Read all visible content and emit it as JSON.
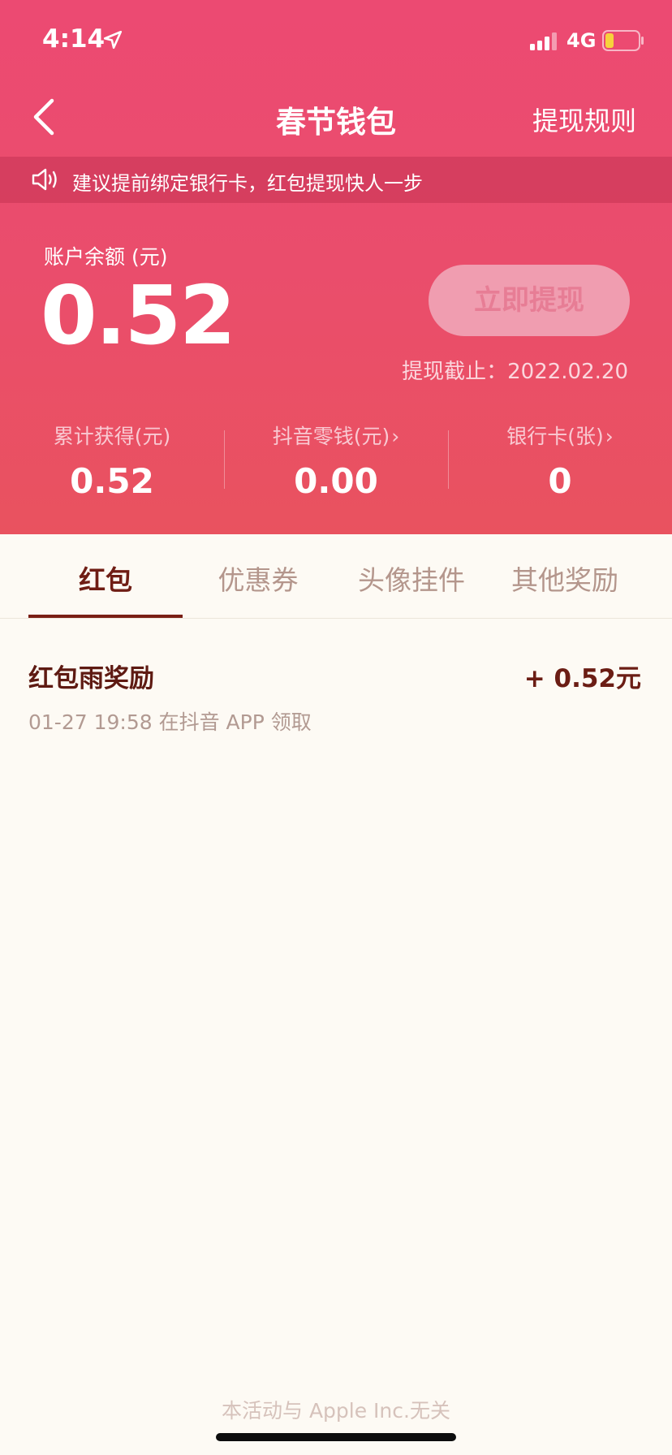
{
  "status_bar": {
    "time": "4:14",
    "network": "4G",
    "icons": [
      "location-arrow-icon",
      "signal-icon",
      "battery-icon"
    ]
  },
  "nav": {
    "title": "春节钱包",
    "right_link": "提现规则",
    "back_icon": "chevron-left-icon"
  },
  "notice": {
    "icon": "speaker-icon",
    "text": "建议提前绑定银行卡，红包提现快人一步"
  },
  "balance": {
    "label": "账户余额 (元)",
    "value": "0.52",
    "withdraw_button": "立即提现",
    "deadline": "提现截止：2022.02.20"
  },
  "stats": [
    {
      "label": "累计获得(元)",
      "value": "0.52",
      "has_arrow": false
    },
    {
      "label": "抖音零钱(元)",
      "value": "0.00",
      "has_arrow": true
    },
    {
      "label": "银行卡(张)",
      "value": "0",
      "has_arrow": true
    }
  ],
  "tabs": [
    {
      "label": "红包",
      "active": true
    },
    {
      "label": "优惠券",
      "active": false
    },
    {
      "label": "头像挂件",
      "active": false
    },
    {
      "label": "其他奖励",
      "active": false
    }
  ],
  "records": [
    {
      "title": "红包雨奖励",
      "amount": "+ 0.52元",
      "subtitle": "01-27 19:58 在抖音 APP 领取"
    }
  ],
  "footer": {
    "note": "本活动与 Apple Inc.无关"
  },
  "colors": {
    "hero_top": "#ec4a72",
    "hero_bottom": "#e9525f",
    "page_background": "#fdfaf4",
    "active_tab": "#7a1f15",
    "withdraw_button_bg": "#f09db0"
  }
}
